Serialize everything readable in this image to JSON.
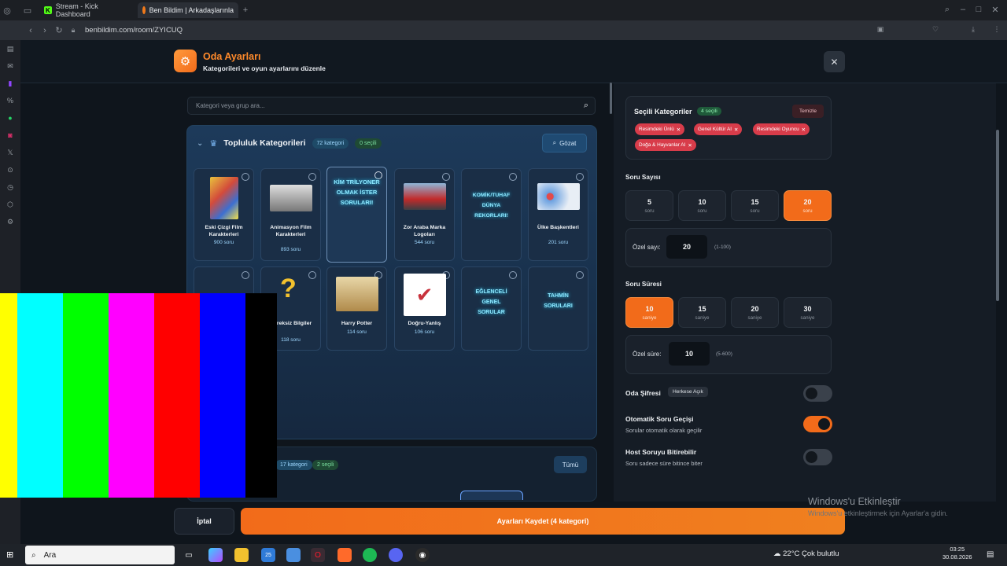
{
  "browser": {
    "tabs": [
      {
        "label": "Stream - Kick Dashboard"
      },
      {
        "label": "Ben Bildim | Arkadaşlarınla"
      }
    ],
    "new_tab": "+",
    "url": "benbildim.com/room/ZYICUQ"
  },
  "header": {
    "title": "Oda Ayarları",
    "subtitle": "Kategorileri ve oyun ayarlarını düzenle",
    "close": "✕"
  },
  "search": {
    "placeholder": "Kategori veya grup ara..."
  },
  "community": {
    "title": "Topluluk Kategorileri",
    "count_badge": "72 kategori",
    "selected_badge": "0 seçili",
    "browse": "Gözat",
    "cards": [
      {
        "name": "Eski Çizgi Film Karakterleri",
        "count": "900 soru"
      },
      {
        "name": "Animasyon Film Karakterleri",
        "count": "893 soru"
      },
      {
        "name": "KİM TRİLYONER OLMAK İSTER SORULARI!",
        "count": ""
      },
      {
        "name": "Zor Araba Marka Logoları",
        "count": "544 soru"
      },
      {
        "name": "KOMİK/TUHAF DÜNYA REKORLARI!",
        "count": ""
      },
      {
        "name": "Ülke Başkentleri",
        "count": "201 soru"
      },
      {
        "name": "Gereksiz Bilgiler",
        "count": "118 soru"
      },
      {
        "name": "Harry Potter",
        "count": "114 soru"
      },
      {
        "name": "Doğru-Yanlış",
        "count": "106 soru"
      },
      {
        "name": "EĞLENCELİ GENEL SORULAR",
        "count": ""
      },
      {
        "name": "TAHMİN SORULARI",
        "count": ""
      }
    ]
  },
  "group2": {
    "count_badge": "17 kategori",
    "selected_badge": "2 seçili",
    "all": "Tümü"
  },
  "selected": {
    "title": "Seçili Kategoriler",
    "count": "4 seçili",
    "clear": "Temizle",
    "chips": [
      "Resimdeki Ünlü",
      "Genel Kültür AI",
      "Resimdeki Oyuncu",
      "Doğa & Hayvanlar AI"
    ]
  },
  "question_count": {
    "label": "Soru Sayısı",
    "options": [
      {
        "value": "5",
        "unit": "soru"
      },
      {
        "value": "10",
        "unit": "soru"
      },
      {
        "value": "15",
        "unit": "soru"
      },
      {
        "value": "20",
        "unit": "soru"
      }
    ],
    "selected": "20",
    "custom_label": "Özel sayı:",
    "custom_value": "20",
    "custom_range": "(1-100)"
  },
  "question_time": {
    "label": "Soru Süresi",
    "options": [
      {
        "value": "10",
        "unit": "saniye"
      },
      {
        "value": "15",
        "unit": "saniye"
      },
      {
        "value": "20",
        "unit": "saniye"
      },
      {
        "value": "30",
        "unit": "saniye"
      }
    ],
    "selected": "10",
    "custom_label": "Özel süre:",
    "custom_value": "10",
    "custom_range": "(5-600)"
  },
  "toggles": {
    "password": {
      "title": "Oda Şifresi",
      "badge": "Herkese Açık",
      "on": false
    },
    "auto_next": {
      "title": "Otomatik Soru Geçişi",
      "sub": "Sorular otomatik olarak geçilir",
      "on": true
    },
    "host_end": {
      "title": "Host Soruyu Bitirebilir",
      "sub": "Soru sadece süre bitince biter",
      "on": false
    }
  },
  "footer": {
    "cancel": "İptal",
    "save": "Ayarları Kaydet (4 kategori)"
  },
  "watermark": {
    "title": "Windows'u Etkinleştir",
    "sub": "Windows'u etkinleştirmek için Ayarlar'a gidin."
  },
  "taskbar": {
    "search_placeholder": "Ara",
    "weather": "22°C Çok bulutlu",
    "time": "03:25",
    "date": "30.08.2026",
    "badge": "25"
  },
  "colors": {
    "accent": "#f26b1a",
    "chip": "#d83c4a",
    "panel": "#18304b"
  }
}
